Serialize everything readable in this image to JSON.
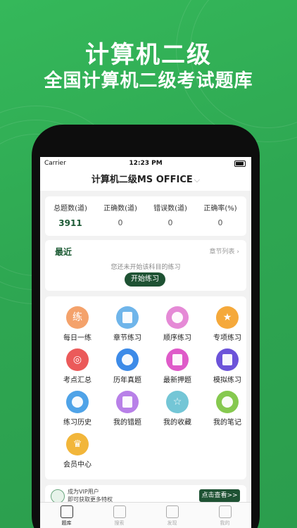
{
  "hero": {
    "title": "计算机二级",
    "subtitle": "全国计算机二级考试题库"
  },
  "status": {
    "carrier": "Carrier",
    "time": "12:23 PM"
  },
  "nav": {
    "title": "计算机二级MS OFFICE",
    "chevron": "⌵"
  },
  "stats": [
    {
      "label": "总题数(道)",
      "value": "3911"
    },
    {
      "label": "正确数(道)",
      "value": "0"
    },
    {
      "label": "错误数(道)",
      "value": "0"
    },
    {
      "label": "正确率(%)",
      "value": "0"
    }
  ],
  "recent": {
    "title": "最近",
    "link": "章节列表 ›",
    "empty": "您还未开始该科目的练习",
    "start": "开始练习"
  },
  "features": [
    {
      "name": "每日一练",
      "icon": "daily-practice-icon",
      "color": "#f4a26b",
      "glyph": "练"
    },
    {
      "name": "章节练习",
      "icon": "chapter-practice-icon",
      "color": "#6fb5ea",
      "glyph": ""
    },
    {
      "name": "顺序练习",
      "icon": "sequence-practice-icon",
      "color": "#e58ad6",
      "glyph": ""
    },
    {
      "name": "专项练习",
      "icon": "special-practice-icon",
      "color": "#f5a93b",
      "glyph": "★"
    },
    {
      "name": "考点汇总",
      "icon": "key-points-icon",
      "color": "#eb5a5a",
      "glyph": "◎"
    },
    {
      "name": "历年真题",
      "icon": "past-papers-icon",
      "color": "#3d8be8",
      "glyph": ""
    },
    {
      "name": "最新押题",
      "icon": "latest-predictions-icon",
      "color": "#df5bc9",
      "glyph": ""
    },
    {
      "name": "模拟练习",
      "icon": "mock-practice-icon",
      "color": "#6c53d9",
      "glyph": ""
    },
    {
      "name": "练习历史",
      "icon": "history-icon",
      "color": "#4fa3e8",
      "glyph": ""
    },
    {
      "name": "我的错题",
      "icon": "wrong-questions-icon",
      "color": "#b880e8",
      "glyph": ""
    },
    {
      "name": "我的收藏",
      "icon": "favorites-icon",
      "color": "#74c6d6",
      "glyph": "☆"
    },
    {
      "name": "我的笔记",
      "icon": "notes-icon",
      "color": "#86c94f",
      "glyph": ""
    },
    {
      "name": "会员中心",
      "icon": "member-center-icon",
      "color": "#f2b63a",
      "glyph": "♛"
    }
  ],
  "vip": {
    "line1": "成为VIP用户",
    "line2": "即可获取更多特权",
    "button": "点击查看>>"
  },
  "tabs": [
    {
      "label": "题库",
      "icon": "question-bank-icon",
      "active": true
    },
    {
      "label": "搜索",
      "icon": "search-icon",
      "active": false
    },
    {
      "label": "发现",
      "icon": "discover-icon",
      "active": false
    },
    {
      "label": "我的",
      "icon": "profile-icon",
      "active": false
    }
  ]
}
